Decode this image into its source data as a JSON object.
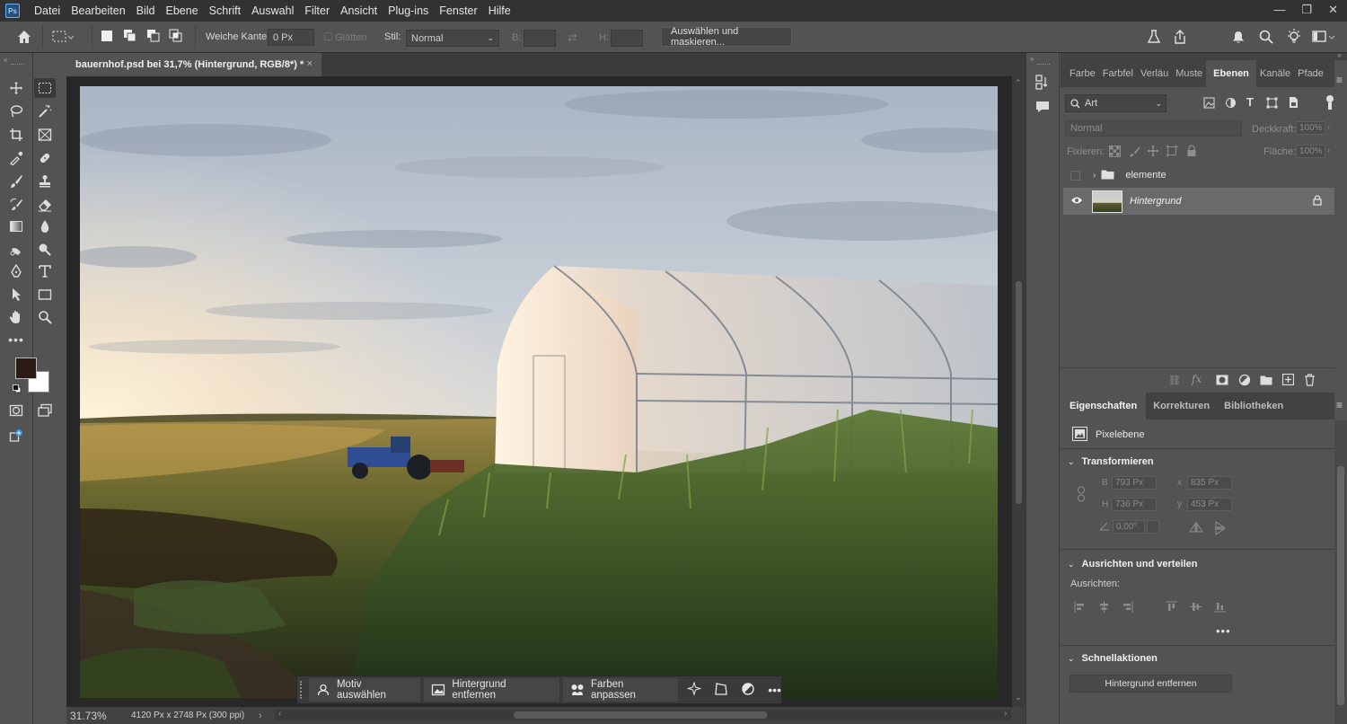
{
  "menubar": {
    "logo": "Ps",
    "items": [
      "Datei",
      "Bearbeiten",
      "Bild",
      "Ebene",
      "Schrift",
      "Auswahl",
      "Filter",
      "Ansicht",
      "Plug-ins",
      "Fenster",
      "Hilfe"
    ]
  },
  "options": {
    "feather_label": "Weiche Kante:",
    "feather_value": "0 Px",
    "antialias_label": "Glätten",
    "style_label": "Stil:",
    "style_value": "Normal",
    "width_label": "B:",
    "height_label": "H:",
    "select_mask_button": "Auswählen und maskieren..."
  },
  "document": {
    "tab_title": "bauernhof.psd bei 31,7% (Hintergrund, RGB/8*) *",
    "zoom": "31.73%",
    "info": "4120 Px x 2748 Px (300 ppi)"
  },
  "taskbar": {
    "select_subject": "Motiv auswählen",
    "remove_background": "Hintergrund entfernen",
    "match_colors": "Farben anpassen"
  },
  "layers_panel": {
    "tabs": [
      "Farbe",
      "Farbfel",
      "Verläu",
      "Muste",
      "Ebenen",
      "Kanäle",
      "Pfade"
    ],
    "active_tab": "Ebenen",
    "filter_value": "Art",
    "blend_mode": "Normal",
    "opacity_label": "Deckkraft:",
    "opacity_value": "100%",
    "lock_label": "Fixieren:",
    "fill_label": "Fläche:",
    "fill_value": "100%",
    "layers": [
      {
        "name": "elemente",
        "type": "group",
        "visible": false
      },
      {
        "name": "Hintergrund",
        "type": "pixel",
        "visible": true,
        "locked": true
      }
    ]
  },
  "properties_panel": {
    "tabs": [
      "Eigenschaften",
      "Korrekturen",
      "Bibliotheken"
    ],
    "active_tab": "Eigenschaften",
    "layer_type": "Pixelebene",
    "transform_title": "Transformieren",
    "w_label": "B",
    "w_value": "793 Px",
    "x_label": "x",
    "x_value": "835 Px",
    "h_label": "H",
    "h_value": "736 Px",
    "y_label": "y",
    "y_value": "453 Px",
    "angle_value": "0,00°",
    "align_title": "Ausrichten und verteilen",
    "align_label": "Ausrichten:",
    "quick_title": "Schnellaktionen",
    "quick_button": "Hintergrund entfernen"
  },
  "colors": {
    "foreground": "#2b1a16",
    "background": "#ffffff"
  }
}
